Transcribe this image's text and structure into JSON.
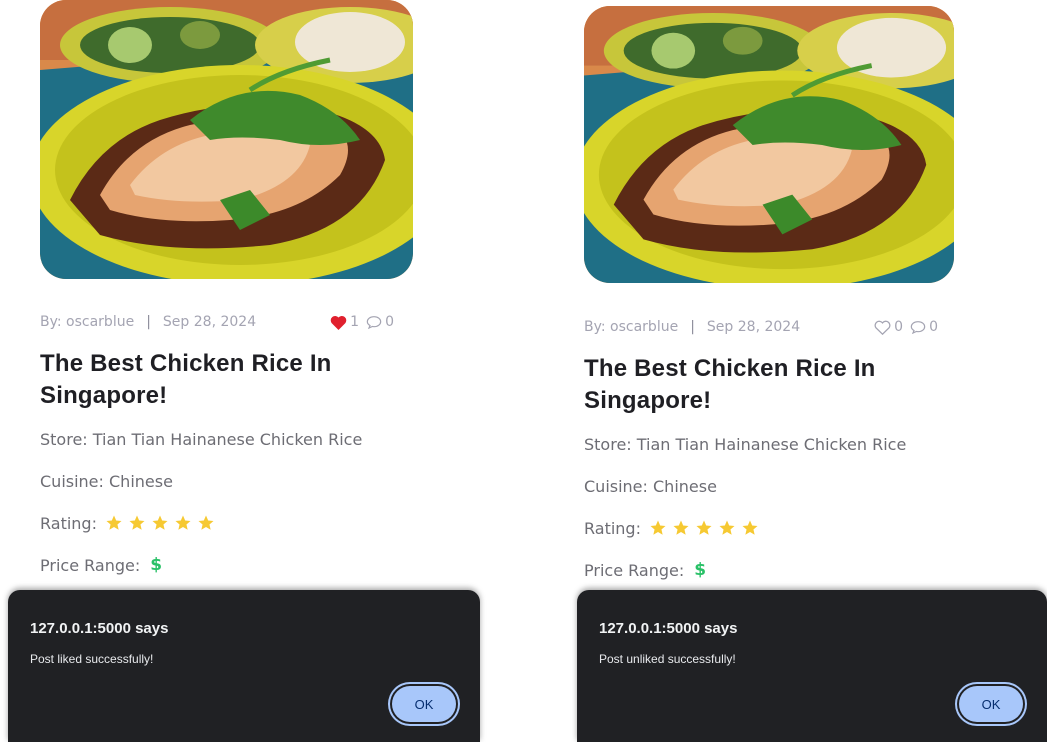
{
  "posts": [
    {
      "author": "By: oscarblue",
      "separator": "|",
      "date": "Sep 28, 2024",
      "likes": "1",
      "comments": "0",
      "liked": true,
      "title": "The Best Chicken Rice In Singapore!",
      "store": "Store: Tian Tian Hainanese Chicken Rice",
      "cuisine": "Cuisine: Chinese",
      "rating_label": "Rating:",
      "rating": 5,
      "price_label": "Price Range:",
      "price": "$",
      "dialog": {
        "title": "127.0.0.1:5000 says",
        "message": "Post liked successfully!",
        "ok_label": "OK"
      }
    },
    {
      "author": "By: oscarblue",
      "separator": "|",
      "date": "Sep 28, 2024",
      "likes": "0",
      "comments": "0",
      "liked": false,
      "title": "The Best Chicken Rice In Singapore!",
      "store": "Store: Tian Tian Hainanese Chicken Rice",
      "cuisine": "Cuisine: Chinese",
      "rating_label": "Rating:",
      "rating": 5,
      "price_label": "Price Range:",
      "price": "$",
      "dialog": {
        "title": "127.0.0.1:5000 says",
        "message": "Post unliked successfully!",
        "ok_label": "OK"
      }
    }
  ],
  "colors": {
    "liked_heart": "#e0202e",
    "star": "#f6c932",
    "price": "#29c167",
    "dialog_bg": "#202124",
    "ok_button": "#a8c7fa"
  }
}
